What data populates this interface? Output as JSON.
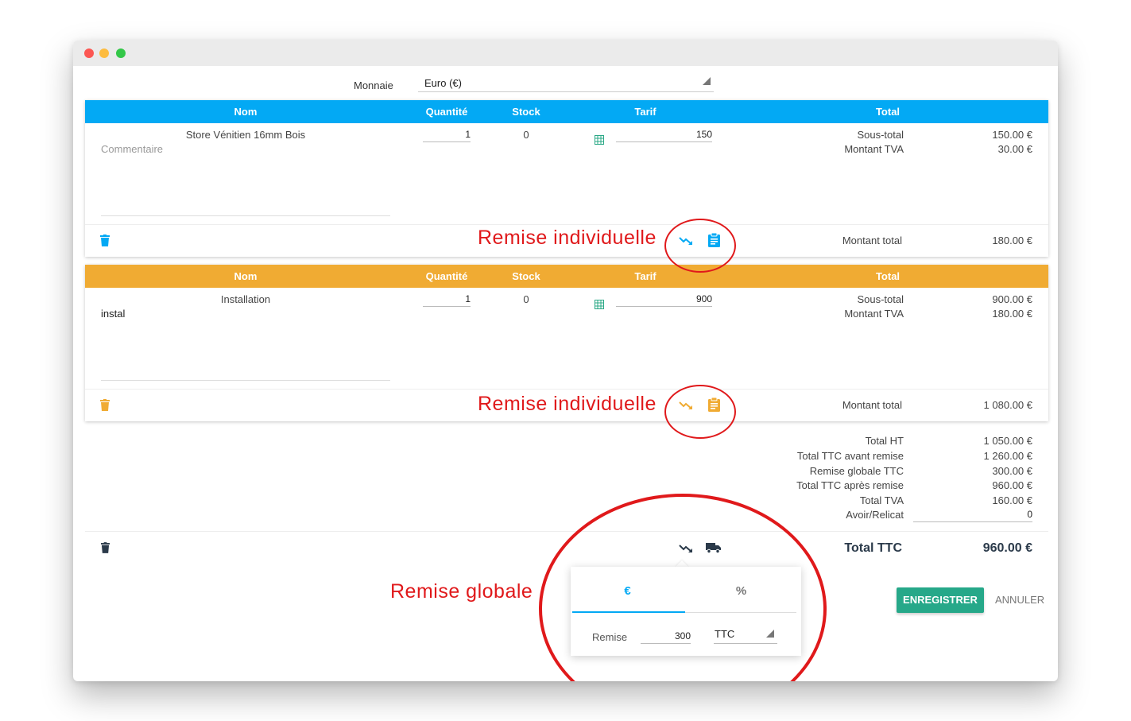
{
  "currency": {
    "label": "Monnaie",
    "value": "Euro (€)"
  },
  "columns": {
    "nom": "Nom",
    "quantite": "Quantité",
    "stock": "Stock",
    "tarif": "Tarif",
    "total": "Total"
  },
  "lines": [
    {
      "name": "Store Vénitien 16mm Bois",
      "comment_placeholder": "Commentaire",
      "comment": "",
      "quantity": "1",
      "stock": "0",
      "price": "150",
      "subtotal_label": "Sous-total",
      "subtotal": "150.00 €",
      "vat_label": "Montant TVA",
      "vat": "30.00 €",
      "total_label": "Montant total",
      "total": "180.00 €",
      "color": "#03a9f4"
    },
    {
      "name": "Installation",
      "comment_placeholder": "",
      "comment": "instal",
      "quantity": "1",
      "stock": "0",
      "price": "900",
      "subtotal_label": "Sous-total",
      "subtotal": "900.00 €",
      "vat_label": "Montant TVA",
      "vat": "180.00 €",
      "total_label": "Montant total",
      "total": "1 080.00 €",
      "color": "#f0ab33"
    }
  ],
  "annotations": {
    "individual": "Remise individuelle",
    "global": "Remise globale"
  },
  "summary": [
    {
      "label": "Total HT",
      "value": "1 050.00 €"
    },
    {
      "label": "Total TTC avant remise",
      "value": "1 260.00 €"
    },
    {
      "label": "Remise globale TTC",
      "value": "300.00 €"
    },
    {
      "label": "Total TTC après remise",
      "value": "960.00 €"
    },
    {
      "label": "Total TVA",
      "value": "160.00 €"
    },
    {
      "label": "Avoir/Relicat",
      "value": "0"
    }
  ],
  "grand_total": {
    "label": "Total TTC",
    "value": "960.00 €"
  },
  "discount_popover": {
    "tab_euro": "€",
    "tab_percent": "%",
    "remise_label": "Remise",
    "remise_value": "300",
    "mode": "TTC"
  },
  "buttons": {
    "save": "ENREGISTRER",
    "cancel": "ANNULER"
  },
  "colors": {
    "blue": "#03a9f4",
    "orange": "#f0ab33",
    "green": "#26a889",
    "annotation_red": "#e0191b",
    "grid_icon": "#2aa886"
  }
}
